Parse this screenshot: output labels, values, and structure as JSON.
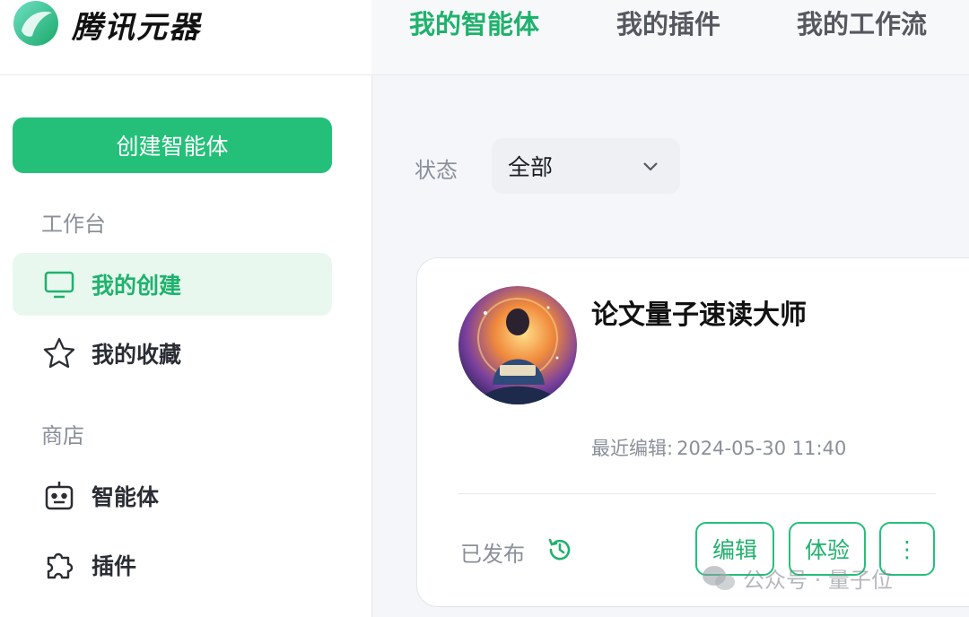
{
  "app": {
    "name": "腾讯元器",
    "logo_icon": "yuanqi-logo"
  },
  "header": {
    "tabs": [
      {
        "label": "我的智能体",
        "active": true
      },
      {
        "label": "我的插件",
        "active": false
      },
      {
        "label": "我的工作流",
        "active": false
      }
    ]
  },
  "sidebar": {
    "create_label": "创建智能体",
    "sections": [
      {
        "title": "工作台",
        "items": [
          {
            "label": "我的创建",
            "icon": "monitor-icon",
            "active": true
          },
          {
            "label": "我的收藏",
            "icon": "star-icon",
            "active": false
          }
        ]
      },
      {
        "title": "商店",
        "items": [
          {
            "label": "智能体",
            "icon": "robot-icon",
            "active": false
          },
          {
            "label": "插件",
            "icon": "puzzle-icon",
            "active": false
          }
        ]
      }
    ]
  },
  "filter": {
    "label": "状态",
    "value": "全部"
  },
  "agent_card": {
    "title": "论文量子速读大师",
    "edited_label": "最近编辑:",
    "edited_value": "2024-05-30 11:40",
    "status": "已发布",
    "buttons": {
      "edit": "编辑",
      "try": "体验",
      "more": "⋮"
    }
  },
  "watermark": "公众号 · 量子位",
  "colors": {
    "accent": "#24c07a",
    "accent_text": "#1fb26d",
    "active_bg": "#e8f8ef"
  }
}
